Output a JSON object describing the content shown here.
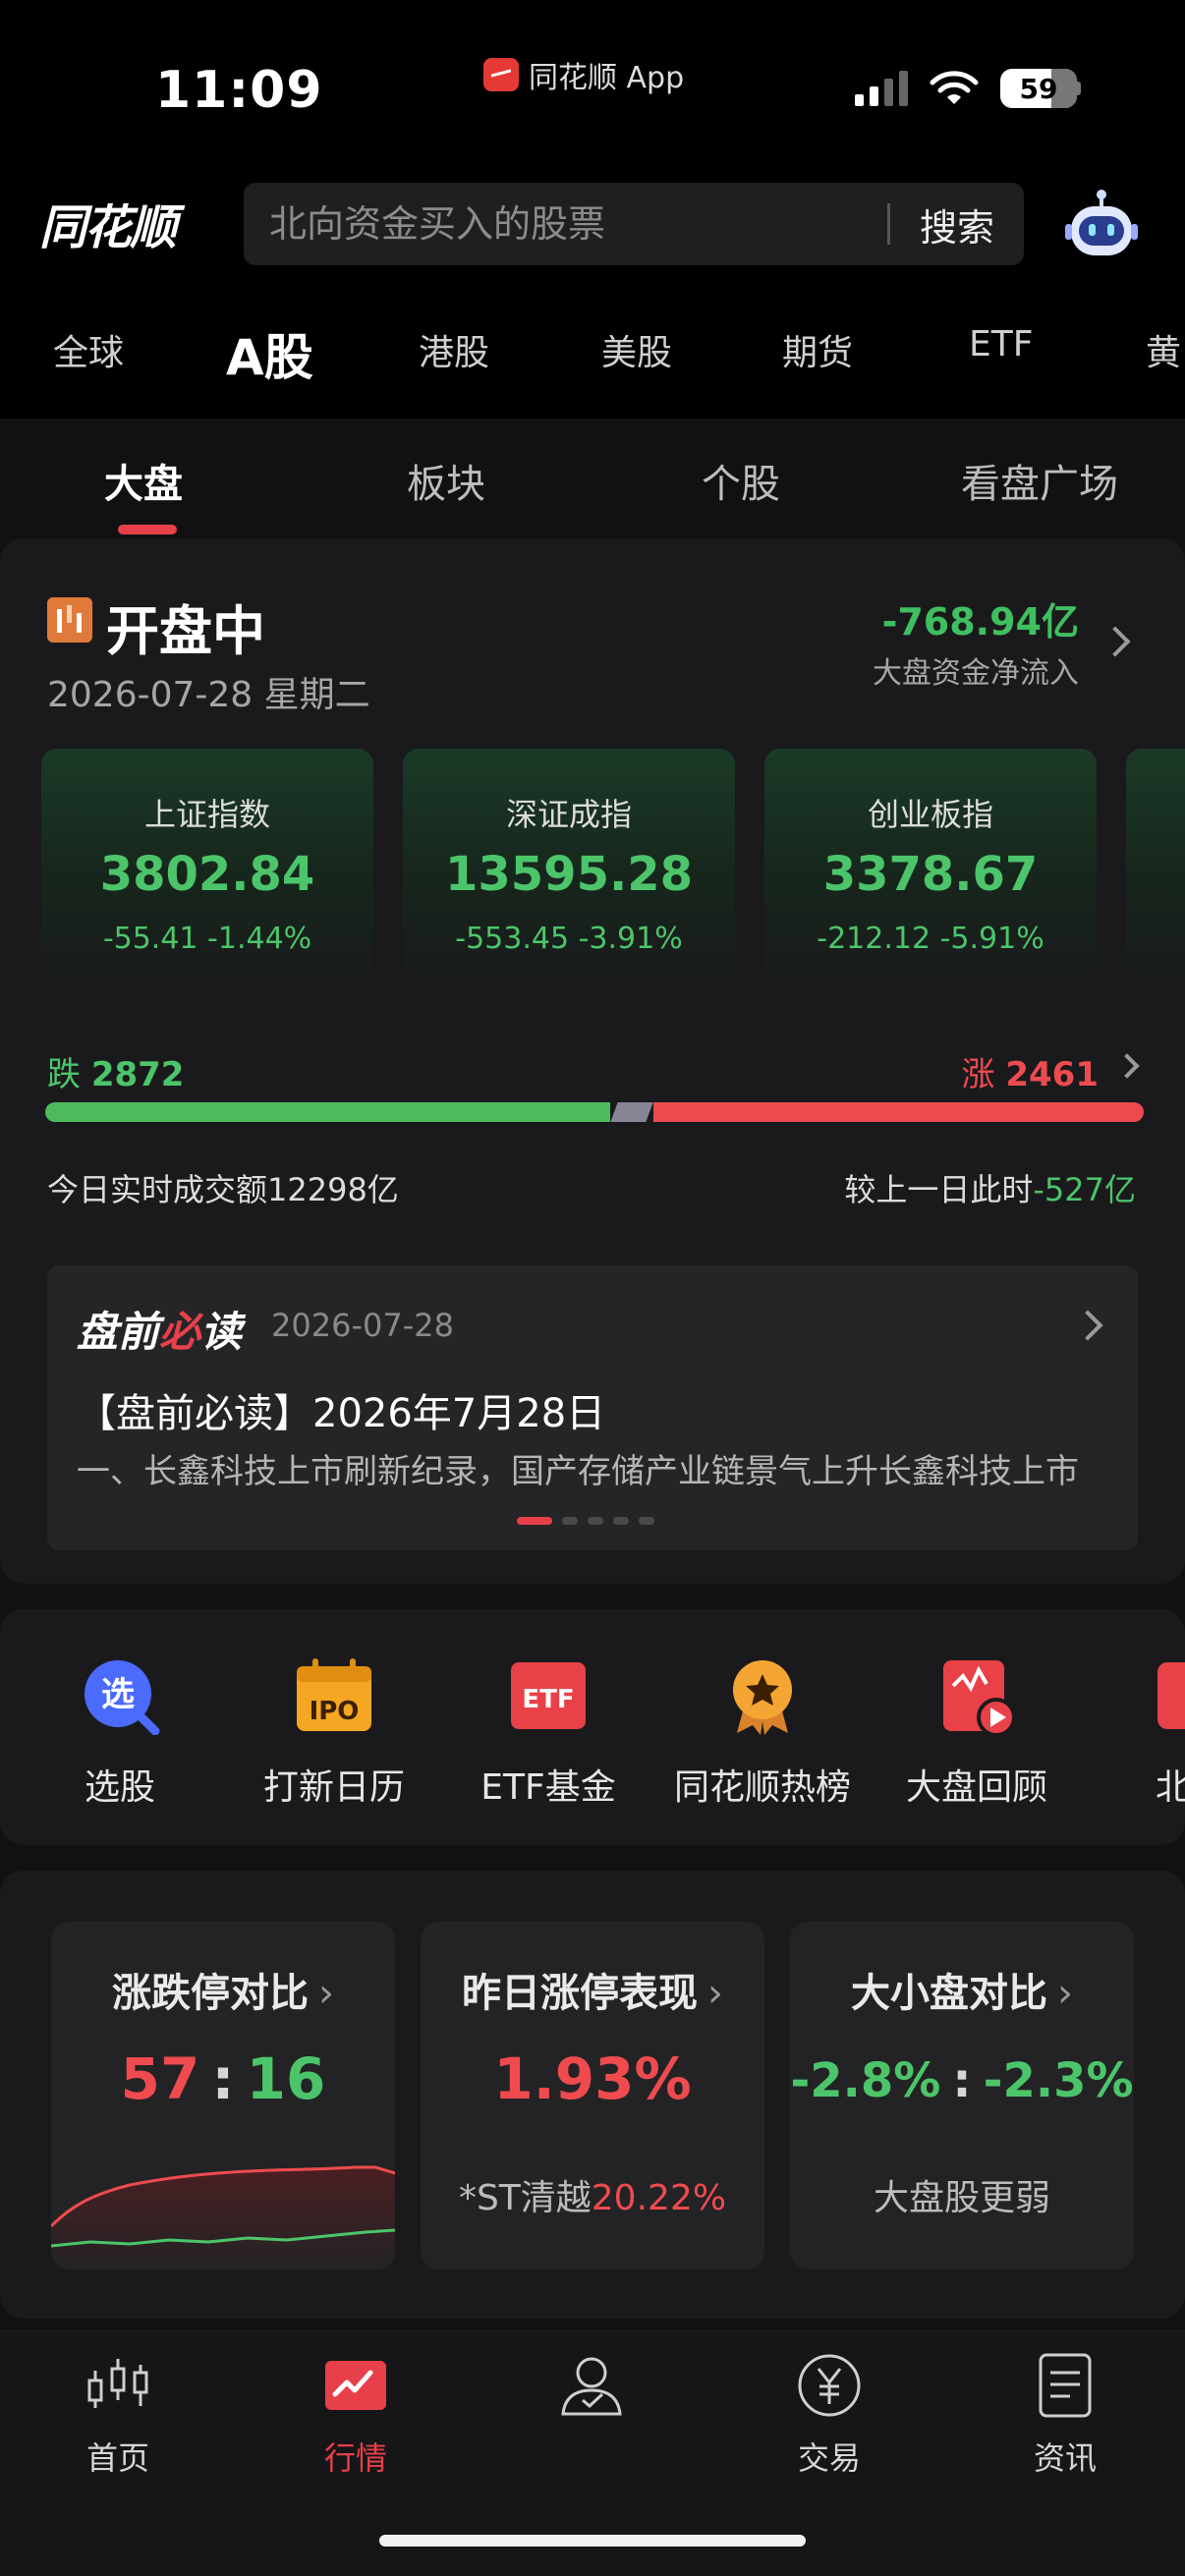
{
  "status_bar": {
    "time": "11:09",
    "app_name": "同花顺 App",
    "battery": "59"
  },
  "header": {
    "logo": "同花顺",
    "search_placeholder": "北向资金买入的股票",
    "search_button": "搜索",
    "icons": [
      "robot-icon"
    ]
  },
  "market_tabs": [
    "全球",
    "A股",
    "港股",
    "美股",
    "期货",
    "ETF",
    "黄"
  ],
  "active_market_tab": "A股",
  "sub_tabs": [
    "大盘",
    "板块",
    "个股",
    "看盘广场"
  ],
  "active_sub_tab": "大盘",
  "market_status": {
    "title": "开盘中",
    "date": "2026-07-28  星期二",
    "net_flow_value": "-768.94亿",
    "net_flow_label": "大盘资金净流入"
  },
  "indices": [
    {
      "name": "上证指数",
      "value": "3802.84",
      "change": "-55.41   -1.44%"
    },
    {
      "name": "深证成指",
      "value": "13595.28",
      "change": "-553.45   -3.91%"
    },
    {
      "name": "创业板指",
      "value": "3378.67",
      "change": "-212.12   -5.91%"
    }
  ],
  "breadth": {
    "down_label": "跌",
    "down_count": "2872",
    "up_label": "涨",
    "up_count": "2461",
    "down_share": 0.535
  },
  "turnover": {
    "label": "今日实时成交额12298亿",
    "compare_label": "较上一日此时",
    "compare_value": "-527亿"
  },
  "news": {
    "logo_a": "盘前",
    "logo_b": "必",
    "logo_c": "读",
    "date": "2026-07-28",
    "title": "【盘前必读】2026年7月28日",
    "body": "一、长鑫科技上市刷新纪录，国产存储产业链景气上升长鑫科技上市"
  },
  "shortcuts": [
    {
      "label": "选股",
      "icon": "stock-picker-icon"
    },
    {
      "label": "打新日历",
      "icon": "ipo-calendar-icon"
    },
    {
      "label": "ETF基金",
      "icon": "etf-fund-icon"
    },
    {
      "label": "同花顺热榜",
      "icon": "hot-list-icon"
    },
    {
      "label": "大盘回顾",
      "icon": "market-review-icon"
    },
    {
      "label": "北交",
      "icon": "bse-icon"
    }
  ],
  "comparisons": [
    {
      "title": "涨跌停对比",
      "left": "57",
      "sep": ":",
      "right": "16"
    },
    {
      "title": "昨日涨停表现",
      "value": "1.93%",
      "sub_prefix": "*ST清越",
      "sub_value": "20.22%"
    },
    {
      "title": "大小盘对比",
      "left": "-2.8%",
      "sep": ":",
      "right": "-2.3%",
      "sub": "大盘股更弱"
    }
  ],
  "bottom_nav": [
    {
      "label": "首页",
      "icon": "candlestick-icon"
    },
    {
      "label": "行情",
      "icon": "market-chart-icon"
    },
    {
      "label": "",
      "icon": "advisor-icon"
    },
    {
      "label": "交易",
      "icon": "yuan-coin-icon"
    },
    {
      "label": "资讯",
      "icon": "news-document-icon"
    }
  ],
  "colors": {
    "rise": "#ef4b4f",
    "fall": "#4cc56a",
    "accent": "#e8404a",
    "background": "#000000"
  }
}
